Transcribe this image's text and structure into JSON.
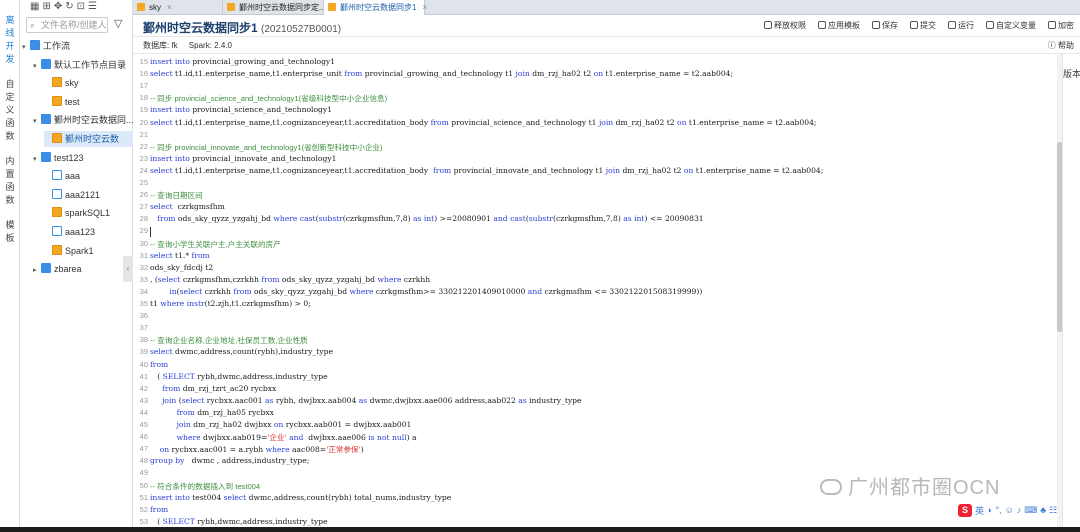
{
  "nav": [
    "离线开发",
    "自定义函数",
    "内置函数",
    "模板"
  ],
  "tree": {
    "search_placeholder": "文件名称/创建人",
    "nodes": [
      {
        "label": "工作流",
        "indent": 0,
        "kind": "folder",
        "arrow": "▾"
      },
      {
        "label": "默认工作节点目录",
        "indent": 1,
        "kind": "folder",
        "arrow": "▾"
      },
      {
        "label": "sky",
        "indent": 2,
        "kind": "file",
        "arrow": ""
      },
      {
        "label": "test",
        "indent": 2,
        "kind": "file",
        "arrow": ""
      },
      {
        "label": "鄞州时空云数据同...",
        "indent": 1,
        "kind": "folder",
        "arrow": "▾"
      },
      {
        "label": "鄞州时空云数",
        "indent": 2,
        "kind": "file",
        "arrow": "",
        "selected": true
      },
      {
        "label": "test123",
        "indent": 1,
        "kind": "folder",
        "arrow": "▾"
      },
      {
        "label": "aaa",
        "indent": 2,
        "kind": "sql",
        "arrow": ""
      },
      {
        "label": "aaa2121",
        "indent": 2,
        "kind": "sql",
        "arrow": ""
      },
      {
        "label": "sparkSQL1",
        "indent": 2,
        "kind": "file",
        "arrow": ""
      },
      {
        "label": "aaa123",
        "indent": 2,
        "kind": "sql",
        "arrow": ""
      },
      {
        "label": "Spark1",
        "indent": 2,
        "kind": "file",
        "arrow": ""
      },
      {
        "label": "zbarea",
        "indent": 1,
        "kind": "folder",
        "arrow": "▸"
      }
    ]
  },
  "tabs": [
    {
      "label": "sky",
      "active": false
    },
    {
      "label": "鄞州时空云数据同步定...",
      "active": false
    },
    {
      "label": "鄞州时空云数据同步1",
      "active": true
    }
  ],
  "header": {
    "title": "鄞州时空云数据同步1",
    "id": "(20210527B0001)",
    "actions": [
      "释放权限",
      "应用模板",
      "保存",
      "提交",
      "运行",
      "自定义变量",
      "加密"
    ]
  },
  "meta": {
    "db": "数据库: fk",
    "spark": "Spark: 2.4.0",
    "help": "帮助"
  },
  "right_tab": "版本",
  "watermark": "广州都市圈OCN",
  "ime": {
    "lang": "英"
  },
  "code": [
    {
      "n": "15",
      "t": "insert into provincial_growing_and_technology1"
    },
    {
      "n": "16",
      "t": "select t1.id,t1.enterprise_name,t1.enterprise_unit from provincial_growing_and_technology t1 join dm_rzj_ha02 t2 on t1.enterprise_name = t2.aab004;"
    },
    {
      "n": "17",
      "t": ""
    },
    {
      "n": "18",
      "t": "-- 同步 provincial_science_and_technology1(省级科技型中小企业信息)"
    },
    {
      "n": "19",
      "t": "insert into provincial_science_and_technology1"
    },
    {
      "n": "20",
      "t": "select t1.id,t1.enterprise_name,t1.cognizanceyear,t1.accreditation_body from provincial_science_and_technology t1 join dm_rzj_ha02 t2 on t1.enterprise_name = t2.aab004;"
    },
    {
      "n": "21",
      "t": ""
    },
    {
      "n": "22",
      "t": "-- 同步 provincial_innovate_and_technology1(省创新型科技中小企业)"
    },
    {
      "n": "23",
      "t": "insert into provincial_innovate_and_technology1"
    },
    {
      "n": "24",
      "t": "select t1.id,t1.enterprise_name,t1.cognizanceyear,t1.accreditation_body  from provincial_innovate_and_technology t1 join dm_rzj_ha02 t2 on t1.enterprise_name = t2.aab004;"
    },
    {
      "n": "25",
      "t": ""
    },
    {
      "n": "26",
      "t": "-- 查询日期区间"
    },
    {
      "n": "27",
      "t": "select  czrkgmsfhm"
    },
    {
      "n": "28",
      "t": "   from ods_sky_qyzz_yzgahj_bd where cast(substr(czrkgmsfhm,7,8) as int) >=20080901 and cast(substr(czrkgmsfhm,7,8) as int) <= 20090831"
    },
    {
      "n": "29",
      "t": ""
    },
    {
      "n": "30",
      "t": "-- 查询小学生关联户主,户主关联的房产"
    },
    {
      "n": "31",
      "t": "select t1.* from"
    },
    {
      "n": "32",
      "t": "ods_sky_fdcdj t2"
    },
    {
      "n": "33",
      "t": ", (select czrkgmsfhm,czrkhh from ods_sky_qyzz_yzgahj_bd where czrkhh"
    },
    {
      "n": "34",
      "t": "        in(select czrkhh from ods_sky_qyzz_yzgahj_bd where czrkgmsfhm>= 330212201409010000 and czrkgmsfhm <= 330212201508319999))"
    },
    {
      "n": "35",
      "t": "t1 where instr(t2.zjh,t1.czrkgmsfhm) > 0;"
    },
    {
      "n": "36",
      "t": ""
    },
    {
      "n": "37",
      "t": ""
    },
    {
      "n": "38",
      "t": "-- 查询企业名称,企业地址,社保员工数,企业性质"
    },
    {
      "n": "39",
      "t": "select dwmc,address,count(rybh),industry_type"
    },
    {
      "n": "40",
      "t": "from"
    },
    {
      "n": "41",
      "t": "   ( SELECT rybh,dwmc,address,industry_type"
    },
    {
      "n": "42",
      "t": "     from dm_rzj_tzrt_ac20 rycbxx"
    },
    {
      "n": "43",
      "t": "     join (select rycbxx.aac001 as rybh, dwjbxx.aab004 as dwmc,dwjbxx.aae006 address,aab022 as industry_type"
    },
    {
      "n": "44",
      "t": "           from dm_rzj_ha05 rycbxx"
    },
    {
      "n": "45",
      "t": "           join dm_rzj_ha02 dwjbxx on rycbxx.aab001 = dwjbxx.aab001"
    },
    {
      "n": "46",
      "t": "           where dwjbxx.aab019='企业' and  dwjbxx.aae006 is not null) a"
    },
    {
      "n": "47",
      "t": "    on rycbxx.aac001 = a.rybh where aac008='正常参保')"
    },
    {
      "n": "48",
      "t": "group by   dwmc , address,industry_type;"
    },
    {
      "n": "49",
      "t": ""
    },
    {
      "n": "50",
      "t": "-- 符合条件的数据插入到 test004"
    },
    {
      "n": "51",
      "t": "insert into test004 select dwmc,address,count(rybh) total_nums,industry_type"
    },
    {
      "n": "52",
      "t": "from"
    },
    {
      "n": "53",
      "t": "   ( SELECT rybh,dwmc,address,industry_type"
    }
  ]
}
